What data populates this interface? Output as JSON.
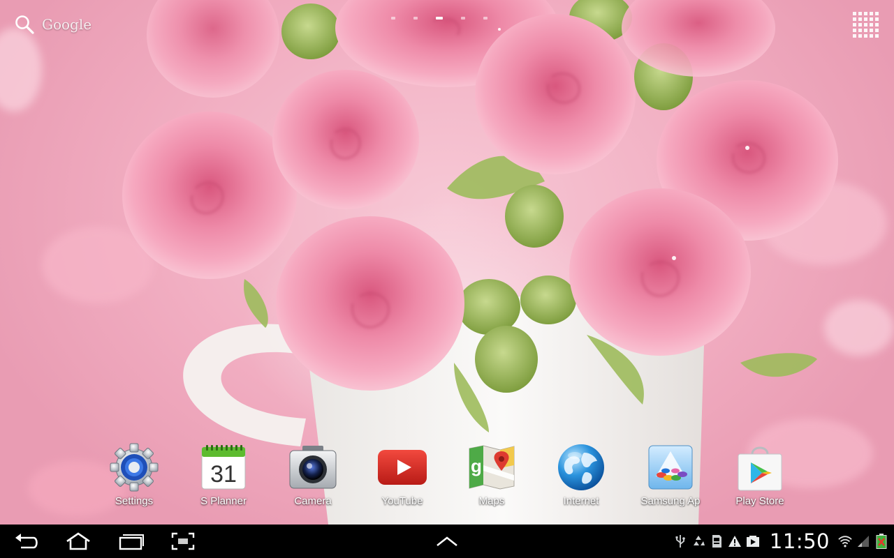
{
  "search": {
    "label": "Google",
    "icon": "search-icon"
  },
  "home": {
    "page_count": 5,
    "active_page": 3,
    "apps_button_icon": "apps-grid-icon"
  },
  "dock": {
    "apps": [
      {
        "label": "Settings",
        "icon": "settings-gear-icon"
      },
      {
        "label": "S Planner",
        "icon": "calendar-icon",
        "calendar_day": "31"
      },
      {
        "label": "Camera",
        "icon": "camera-icon"
      },
      {
        "label": "YouTube",
        "icon": "youtube-icon"
      },
      {
        "label": "Maps",
        "icon": "maps-icon"
      },
      {
        "label": "Internet",
        "icon": "globe-icon"
      },
      {
        "label": "Samsung Ap",
        "icon": "samsung-apps-icon"
      },
      {
        "label": "Play Store",
        "icon": "play-store-icon"
      }
    ]
  },
  "navbar": {
    "buttons": [
      "back-icon",
      "home-icon",
      "recent-apps-icon",
      "screenshot-icon"
    ],
    "center": "chevron-up-icon"
  },
  "status": {
    "time": "11:50",
    "icons": [
      "usb-icon",
      "recycle-icon",
      "sd-card-icon",
      "warning-icon",
      "media-icon",
      "wifi-icon",
      "signal-icon",
      "battery-icon"
    ]
  },
  "colors": {
    "navbar_bg": "#000000",
    "wallpaper_pink": "#f1adc1",
    "youtube_red": "#e52d27",
    "calendar_green": "#5dbb2f"
  }
}
